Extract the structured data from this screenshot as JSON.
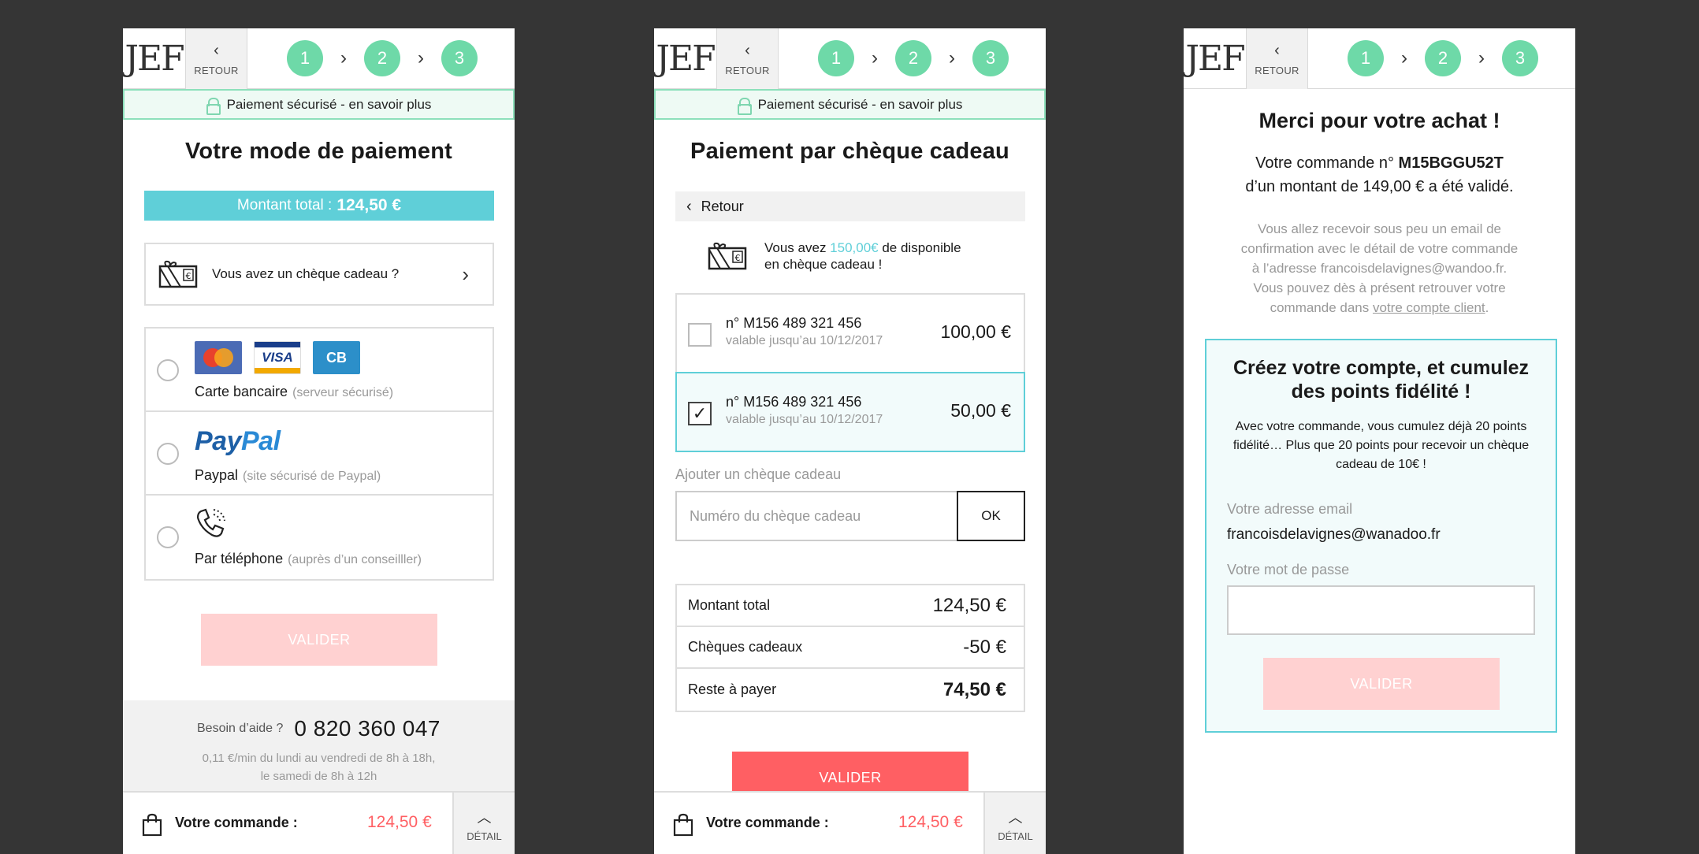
{
  "header": {
    "logo": "JEF",
    "back_label": "RETOUR",
    "steps": [
      "1",
      "2",
      "3"
    ],
    "step_separator": "›"
  },
  "secure_banner": "Paiement sécurisé - en savoir plus",
  "footer": {
    "order_label": "Votre commande :",
    "order_amount": "124,50 €",
    "detail_label": "DÉTAIL"
  },
  "screen1": {
    "title": "Votre mode de paiement",
    "total_label": "Montant total :",
    "total_value": "124,50 €",
    "gift_question": "Vous avez un chèque cadeau ?",
    "payment_options": [
      {
        "name": "Carte bancaire",
        "sub": "(serveur sécurisé)"
      },
      {
        "name": "Paypal",
        "sub": "(site sécurisé de Paypal)"
      },
      {
        "name": "Par téléphone",
        "sub": "(auprès d’un conseilller)"
      }
    ],
    "card_logos": {
      "visa": "VISA",
      "cb": "CB"
    },
    "paypal_logo": {
      "pay": "Pay",
      "pal": "Pal"
    },
    "validate": "VALIDER",
    "help": {
      "ask": "Besoin d’aide ?",
      "phone": "0 820 360 047",
      "hours_line1": "0,11 €/min du lundi au vendredi de 8h à 18h,",
      "hours_line2": "le samedi de 8h à 12h"
    }
  },
  "screen2": {
    "title": "Paiement par chèque cadeau",
    "back": "Retour",
    "available_prefix": "Vous avez ",
    "available_amount": "150,00€",
    "available_suffix": " de disponible",
    "available_line2": "en chèque cadeau !",
    "cheques": [
      {
        "number": "n° M156 489 321 456",
        "validity": "valable jusqu’au 10/12/2017",
        "amount": "100,00 €",
        "checked": false
      },
      {
        "number": "n° M156 489 321 456",
        "validity": "valable jusqu’au 10/12/2017",
        "amount": "50,00 €",
        "checked": true
      }
    ],
    "add_label": "Ajouter un chèque cadeau",
    "add_placeholder": "Numéro du chèque cadeau",
    "ok": "OK",
    "summary": [
      {
        "label": "Montant total",
        "value": "124,50 €"
      },
      {
        "label": "Chèques cadeaux",
        "value": "-50 €"
      },
      {
        "label": "Reste à payer",
        "value": "74,50 €"
      }
    ],
    "validate": "VALIDER"
  },
  "screen3": {
    "title": "Merci pour votre achat !",
    "order_prefix": "Votre commande n° ",
    "order_number": "M15BGGU52T",
    "order_line2": "d’un montant de 149,00 €  a été validé.",
    "confirm_line1": "Vous allez recevoir sous peu un email de",
    "confirm_line2": "confirmation avec le détail de votre commande",
    "confirm_line3": "à l’adresse francoisdelavignes@wandoo.fr.",
    "confirm_line4": "Vous pouvez dès à présent retrouver votre",
    "confirm_line5_prefix": "commande dans ",
    "confirm_link": "votre compte client",
    "confirm_line5_suffix": ".",
    "account": {
      "heading_line1": "Créez votre compte, et cumulez",
      "heading_line2": "des points fidélité !",
      "text_line1": "Avec votre commande, vous cumulez déjà 20 points",
      "text_line2": "fidélité… Plus que 20 points pour recevoir un chèque",
      "text_line3": "cadeau de 10€ !",
      "email_label": "Votre adresse email",
      "email_value": "francoisdelavignes@wanadoo.fr",
      "password_label": "Votre mot de passe",
      "validate": "VALIDER"
    }
  },
  "colors": {
    "step_green": "#6ed9a8",
    "secure_bg": "#eefaf4",
    "secure_border": "#8de0bb",
    "teal": "#5fcfd8",
    "red": "#ff5f63",
    "disabled_pink": "#ffd1d1",
    "background": "#353535"
  },
  "icons": [
    "chevron-left-icon",
    "lock-icon",
    "gift-card-icon",
    "chevron-right-icon",
    "mastercard-icon",
    "visa-icon",
    "cb-icon",
    "paypal-logo",
    "phone-icon",
    "shopping-bag-icon",
    "chevron-up-icon",
    "checkmark-icon"
  ]
}
